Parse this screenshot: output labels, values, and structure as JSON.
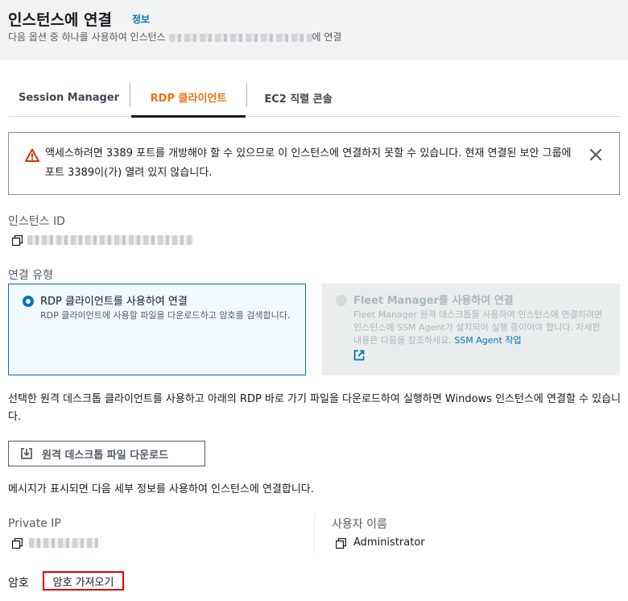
{
  "header": {
    "title": "인스턴스에 연결",
    "info_link": "정보",
    "subtitle_prefix": "다음 옵션 중 하나를 사용하여 인스턴스 ",
    "subtitle_suffix": "에 연결"
  },
  "tabs": [
    {
      "label": "Session Manager"
    },
    {
      "label": "RDP 클라이언트"
    },
    {
      "label": "EC2 직렬 콘솔"
    }
  ],
  "alert": {
    "text": "액세스하려면 3389 포트를 개방해야 할 수 있으므로 이 인스턴스에 연결하지 못할 수 있습니다. 현재 연결된 보안 그룹에 포트 3389이(가) 열려 있지 않습니다."
  },
  "instance_id": {
    "label": "인스턴스 ID"
  },
  "connection_type": {
    "label": "연결 유형",
    "rdp": {
      "title": "RDP 클라이언트를 사용하여 연결",
      "desc": "RDP 클라이언트에 사용할 파일을 다운로드하고 암호를 검색합니다."
    },
    "fleet": {
      "title": "Fleet Manager를 사용하여 연결",
      "desc": "Fleet Manager 원격 데스크톱을 사용하여 인스턴스에 연결하려면 인스턴스에 SSM Agent가 설치되어 실행 중이어야 합니다. 자세한 내용은 다음을 참조하세요. ",
      "link": "SSM Agent 작업"
    }
  },
  "instructions": "선택한 원격 데스크톱 클라이언트를 사용하고 아래의 RDP 바로 가기 파일을 다운로드하여 실행하면 Windows 인스턴스에 연결할 수 있습니다.",
  "download_button": "원격 데스크톱 파일 다운로드",
  "prompt_text": "메시지가 표시되면 다음 세부 정보를 사용하여 인스턴스에 연결합니다.",
  "private_ip": {
    "label": "Private IP"
  },
  "username": {
    "label": "사용자 이름",
    "value": "Administrator"
  },
  "password": {
    "label": "암호",
    "button": "암호 가져오기"
  },
  "colors": {
    "accent_orange": "#ec7211",
    "link_blue": "#0073bb",
    "alert_red": "#d13212",
    "highlight_red": "#e00000"
  }
}
